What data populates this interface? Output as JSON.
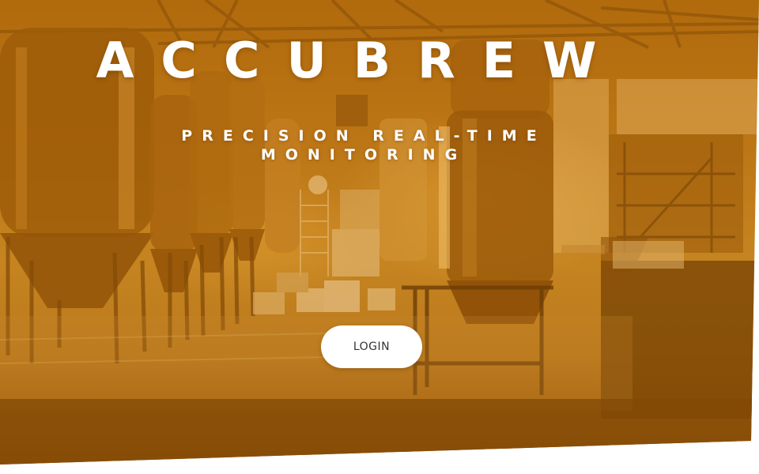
{
  "hero": {
    "title": "ACCUBREW",
    "tagline": "PRECISION REAL-TIME MONITORING",
    "background_scene": "brewery-fermentation-tanks",
    "tint_color": "#c4780a"
  },
  "actions": {
    "login_label": "LOGIN"
  },
  "colors": {
    "title_text": "#ffffff",
    "button_bg": "#ffffff",
    "button_text": "#333333"
  }
}
